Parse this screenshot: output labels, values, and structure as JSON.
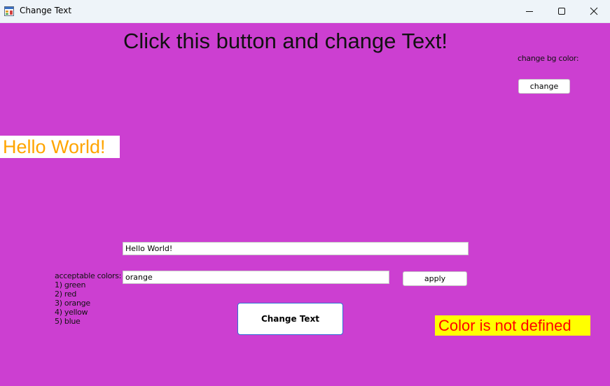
{
  "window": {
    "title": "Change Text"
  },
  "colors": {
    "client_bg": "#cc3fd1",
    "hello_text": "#ffa500",
    "warning_bg": "#ffff00",
    "warning_text": "#ff0000"
  },
  "main": {
    "heading": "Click this button and change Text!",
    "bg_color_label": "change bg color:",
    "change_bg_button": "change",
    "hello_label": "Hello World!",
    "text_input_value": "Hello World!",
    "colors_heading": "acceptable colors:",
    "acceptable_colors": [
      "1) green",
      "2) red",
      "3) orange",
      "4) yellow",
      "5) blue"
    ],
    "color_input_value": "orange",
    "apply_button": "apply",
    "change_text_button": "Change Text",
    "status_message": "Color is not defined"
  }
}
